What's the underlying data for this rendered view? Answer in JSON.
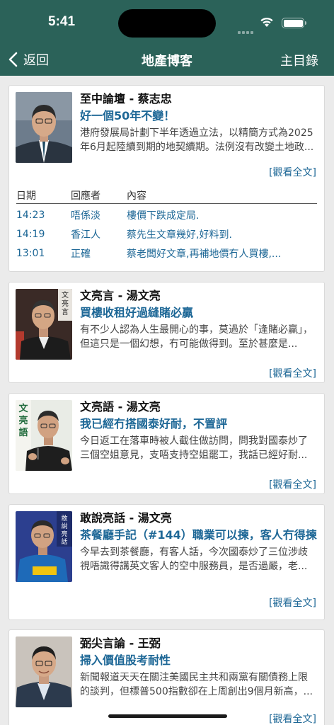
{
  "status": {
    "time": "5:41"
  },
  "nav": {
    "back_label": "返回",
    "title": "地產博客",
    "menu_label": "主目錄"
  },
  "read_more": "[觀看全文]",
  "posts": [
    {
      "author": "至中論壇 - 蔡志忠",
      "headline": "好一個50年不變！",
      "excerpt": "港府發展局計劃下半年透過立法，以精簡方式為2025年6月起陸續到期的地契續期。法例沒有改變土地政...",
      "read_more": "[觀看全文]"
    },
    {
      "author": "文亮言 - 湯文亮",
      "headline": "買樓收租好過縫賭必贏",
      "excerpt": "有不少人認為人生最開心的事，莫過於「逢賭必贏」，但這只是一個幻想，冇可能做得到。至於甚麼是...",
      "read_more": "[觀看全文]",
      "photo_text": "文亮言"
    },
    {
      "author": "文亮語 - 湯文亮",
      "headline": "我已經冇搭國泰好耐，不置評",
      "excerpt": "今日返工在落車時被人截住做訪問，問我對國泰炒了三個空姐意見，支唔支持空姐罷工，我話已經好耐...",
      "read_more": "[觀看全文]",
      "photo_text": "文亮語"
    },
    {
      "author": "敢說亮話 - 湯文亮",
      "headline": "茶餐廳手記（#144）職業可以揀，客人冇得揀",
      "excerpt": "今早去到茶餐廳，有客人話，今次國泰炒了三位涉歧視唔識得講英文客人的空中服務員，是否過嚴，老...",
      "read_more": "[觀看全文]",
      "photo_text": "敢說亮話"
    },
    {
      "author": "弼尖言論 - 王弼",
      "headline": "掃入價值股考耐性",
      "excerpt": "新聞報道天天在關注美國民主共和兩黨有關債務上限的談判，但標普500指數卻在上周創出9個月新高，...",
      "read_more": "[觀看全文]"
    }
  ],
  "comments": {
    "headers": {
      "date": "日期",
      "replier": "回應者",
      "content": "內容"
    },
    "rows": [
      {
        "time": "14:23",
        "user": "唔係淡",
        "text": "樓價下跌成定局."
      },
      {
        "time": "14:19",
        "user": "香江人",
        "text": "蔡先生文章幾好,好料到."
      },
      {
        "time": "13:01",
        "user": "正確",
        "text": "蔡老闆好文章,再補地價冇人買樓,..."
      }
    ]
  }
}
